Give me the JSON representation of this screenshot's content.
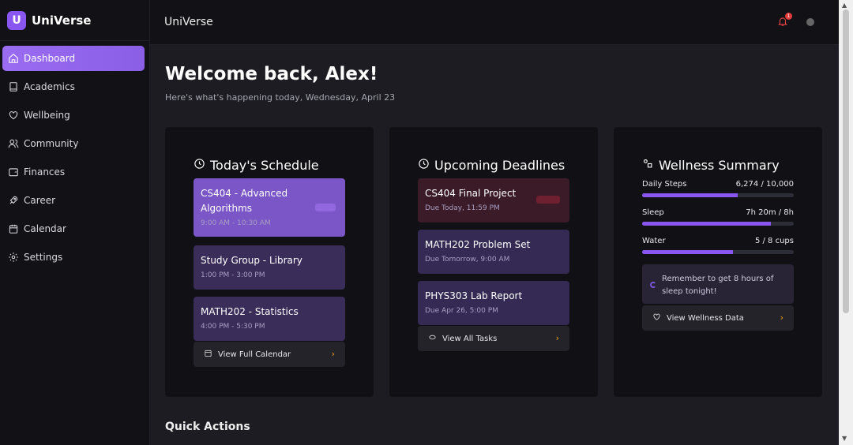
{
  "brand": {
    "logo_letter": "U",
    "name": "UniVerse"
  },
  "sidebar": {
    "items": [
      {
        "label": "Dashboard",
        "icon": "home-icon",
        "active": true
      },
      {
        "label": "Academics",
        "icon": "book-icon"
      },
      {
        "label": "Wellbeing",
        "icon": "heart-icon"
      },
      {
        "label": "Community",
        "icon": "users-icon"
      },
      {
        "label": "Finances",
        "icon": "wallet-icon"
      },
      {
        "label": "Career",
        "icon": "rocket-icon"
      },
      {
        "label": "Calendar",
        "icon": "calendar-icon"
      },
      {
        "label": "Settings",
        "icon": "gear-icon"
      }
    ]
  },
  "header": {
    "title": "UniVerse",
    "notification_count": "1"
  },
  "main": {
    "welcome": "Welcome back, Alex!",
    "subtitle": "Here's what's happening today, Wednesday, April 23",
    "quick_actions": "Quick Actions"
  },
  "schedule": {
    "title": "Today's Schedule",
    "items": [
      {
        "title": "CS404 - Advanced Algorithms",
        "time": "9:00 AM - 10:30 AM",
        "highlight": true
      },
      {
        "title": "Study Group - Library",
        "time": "1:00 PM - 3:00 PM"
      },
      {
        "title": "MATH202 - Statistics",
        "time": "4:00 PM - 5:30 PM"
      }
    ],
    "footer": "View Full Calendar"
  },
  "deadlines": {
    "title": "Upcoming Deadlines",
    "items": [
      {
        "title": "CS404 Final Project",
        "due": "Due Today, 11:59 PM",
        "urgent": true
      },
      {
        "title": "MATH202 Problem Set",
        "due": "Due Tomorrow, 9:00 AM"
      },
      {
        "title": "PHYS303 Lab Report",
        "due": "Due Apr 26, 5:00 PM"
      }
    ],
    "footer": "View All Tasks"
  },
  "wellness": {
    "title": "Wellness Summary",
    "metrics": [
      {
        "label": "Daily Steps",
        "value": "6,274 / 10,000",
        "progress": 0.63
      },
      {
        "label": "Sleep",
        "value": "7h 20m / 8h",
        "progress": 0.85
      },
      {
        "label": "Water",
        "value": "5 / 8 cups",
        "progress": 0.6
      }
    ],
    "reminder": "Remember to get 8 hours of sleep tonight!",
    "footer": "View Wellness Data"
  },
  "colors": {
    "accent": "#8a56f0",
    "danger": "#e43c3c",
    "chevron": "#f0a020"
  }
}
